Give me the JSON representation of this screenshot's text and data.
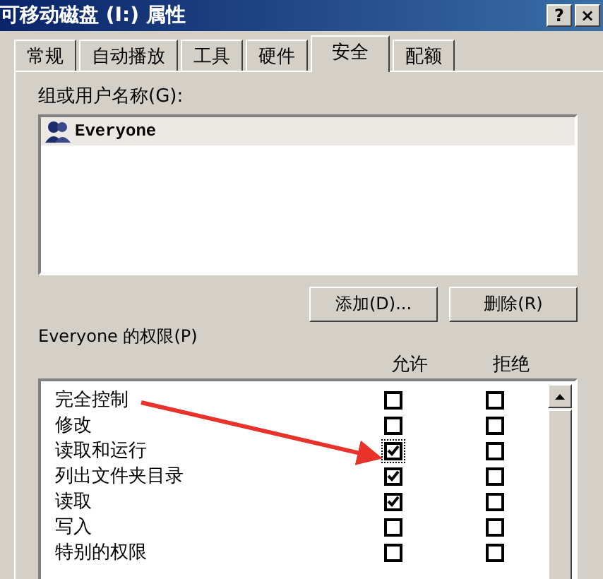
{
  "window": {
    "title": "可移动磁盘 (I:) 属性",
    "help_button": "?",
    "close_button": "×"
  },
  "tabs": [
    {
      "label": "常规",
      "selected": false
    },
    {
      "label": "自动播放",
      "selected": false
    },
    {
      "label": "工具",
      "selected": false
    },
    {
      "label": "硬件",
      "selected": false
    },
    {
      "label": "安全",
      "selected": true
    },
    {
      "label": "配额",
      "selected": false
    }
  ],
  "groups_label": "组或用户名称(G):",
  "users": [
    {
      "name": "Everyone",
      "selected": true
    }
  ],
  "buttons": [
    "添加(D)...",
    "删除(R)"
  ],
  "permissions_label": "Everyone 的权限(P)",
  "columns": [
    "允许",
    "拒绝"
  ],
  "permissions": [
    {
      "name": "完全控制",
      "allow": false,
      "deny": false,
      "focused": false
    },
    {
      "name": "修改",
      "allow": false,
      "deny": false,
      "focused": false
    },
    {
      "name": "读取和运行",
      "allow": true,
      "deny": false,
      "focused": true
    },
    {
      "name": "列出文件夹目录",
      "allow": true,
      "deny": false,
      "focused": false
    },
    {
      "name": "读取",
      "allow": true,
      "deny": false,
      "focused": false
    },
    {
      "name": "写入",
      "allow": false,
      "deny": false,
      "focused": false
    },
    {
      "name": "特别的权限",
      "allow": false,
      "deny": false,
      "focused": false
    }
  ]
}
